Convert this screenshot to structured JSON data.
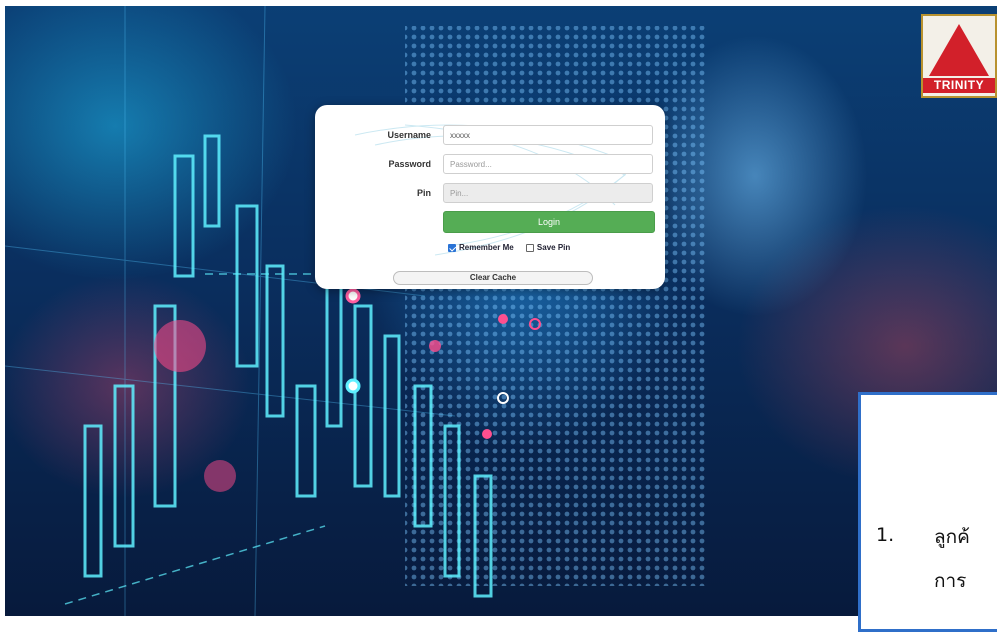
{
  "brand": {
    "logo_text": "TRINITY",
    "logo_color": "#d2202a",
    "logo_border": "#b8922f"
  },
  "login": {
    "username_label": "Username",
    "username_value": "xxxxx",
    "password_label": "Password",
    "password_placeholder": "Password...",
    "pin_label": "Pin",
    "pin_placeholder": "Pin...",
    "login_button": "Login",
    "remember_me_label": "Remember Me",
    "remember_me_checked": true,
    "save_pin_label": "Save Pin",
    "save_pin_checked": false,
    "clear_cache_button": "Clear Cache",
    "accent_color": "#55ad55"
  },
  "note": {
    "number": "1.",
    "line1": "ลูกค้",
    "line2": "การ",
    "border_color": "#2f6fc9"
  }
}
